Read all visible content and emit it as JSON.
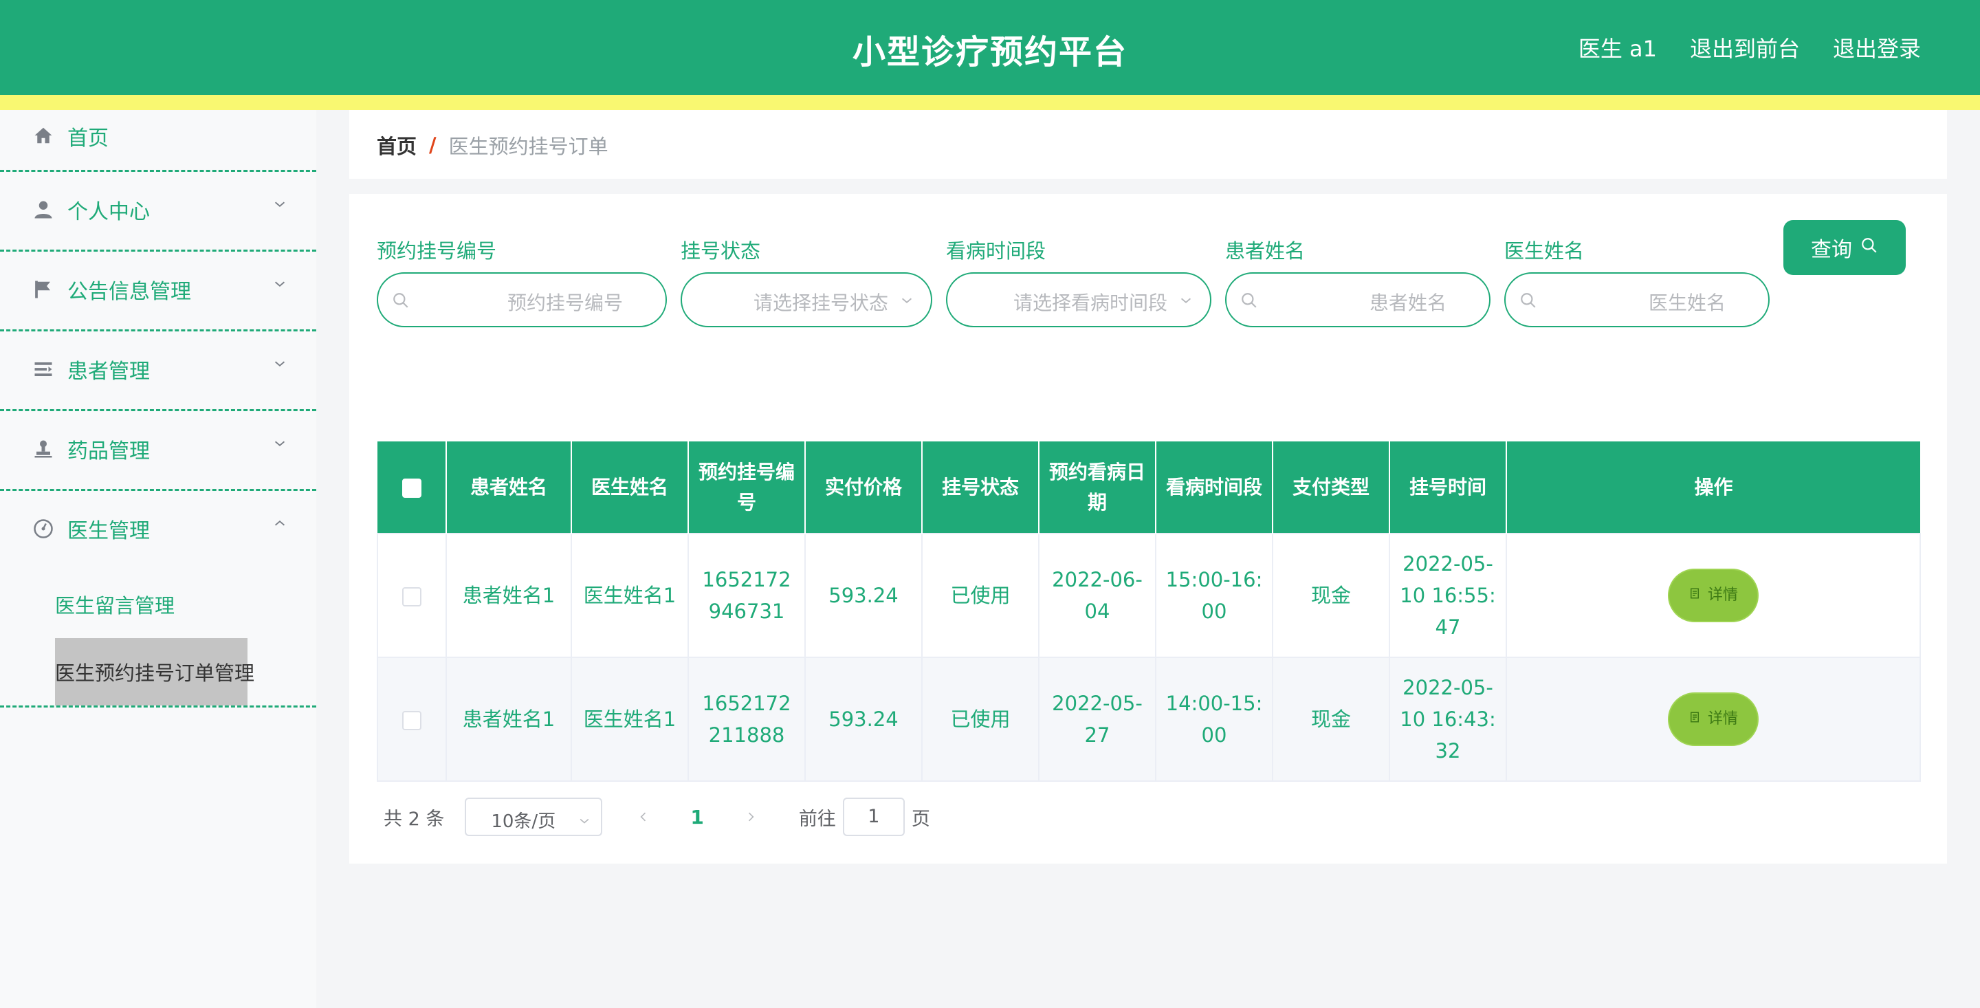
{
  "header": {
    "title": "小型诊疗预约平台",
    "user": "医生 a1",
    "back_to_front": "退出到前台",
    "logout": "退出登录"
  },
  "sidebar": {
    "items": [
      {
        "label": "首页",
        "icon": "home-icon"
      },
      {
        "label": "个人中心",
        "icon": "user-icon"
      },
      {
        "label": "公告信息管理",
        "icon": "flag-icon"
      },
      {
        "label": "患者管理",
        "icon": "list-icon"
      },
      {
        "label": "药品管理",
        "icon": "stamp-icon"
      },
      {
        "label": "医生管理",
        "icon": "gauge-icon"
      }
    ],
    "sub_items": [
      {
        "label": "医生留言管理"
      },
      {
        "label": "医生预约挂号订单管理"
      }
    ]
  },
  "breadcrumb": {
    "home": "首页",
    "separator": "/",
    "current": "医生预约挂号订单"
  },
  "search": {
    "fields": [
      {
        "label": "预约挂号编号",
        "placeholder": "预约挂号编号",
        "type": "input"
      },
      {
        "label": "挂号状态",
        "placeholder": "请选择挂号状态",
        "type": "select"
      },
      {
        "label": "看病时间段",
        "placeholder": "请选择看病时间段",
        "type": "select"
      },
      {
        "label": "患者姓名",
        "placeholder": "患者姓名",
        "type": "input"
      },
      {
        "label": "医生姓名",
        "placeholder": "医生姓名",
        "type": "input"
      }
    ],
    "query_label": "查询"
  },
  "table": {
    "headers": [
      "患者姓名",
      "医生姓名",
      "预约挂号编号",
      "实付价格",
      "挂号状态",
      "预约看病日期",
      "看病时间段",
      "支付类型",
      "挂号时间",
      "操作"
    ],
    "rows": [
      {
        "patient": "患者姓名1",
        "doctor": "医生姓名1",
        "order_no": "1652172946731",
        "price": "593.24",
        "status": "已使用",
        "date": "2022-06-04",
        "slot": "15:00-16:00",
        "pay_type": "现金",
        "created": "2022-05-10 16:55:47",
        "action": "详情"
      },
      {
        "patient": "患者姓名1",
        "doctor": "医生姓名1",
        "order_no": "1652172211888",
        "price": "593.24",
        "status": "已使用",
        "date": "2022-05-27",
        "slot": "14:00-15:00",
        "pay_type": "现金",
        "created": "2022-05-10 16:43:32",
        "action": "详情"
      }
    ]
  },
  "pagination": {
    "total": "共 2 条",
    "page_size": "10条/页",
    "current_page": "1",
    "goto_label": "前往",
    "goto_value": "1",
    "page_suffix": "页"
  },
  "colors": {
    "primary": "#1faa78",
    "accent_yellow": "#f9f871",
    "detail_button": "#8dc63f"
  }
}
